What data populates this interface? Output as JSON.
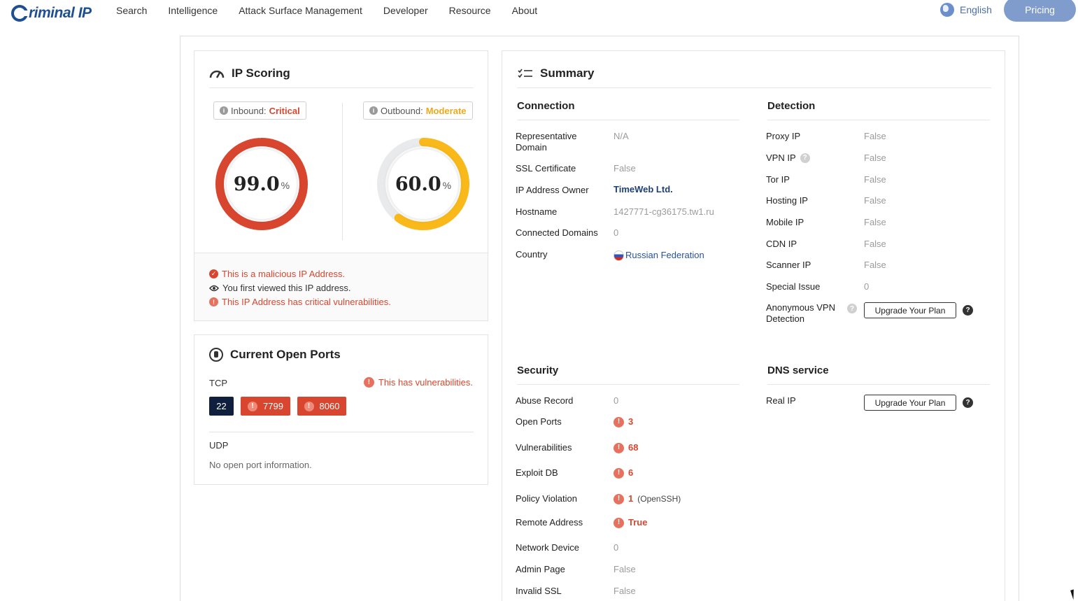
{
  "header": {
    "logo_text": "riminal IP",
    "nav": [
      "Search",
      "Intelligence",
      "Attack Surface Management",
      "Developer",
      "Resource",
      "About"
    ],
    "language": "English",
    "pricing": "Pricing"
  },
  "scoring": {
    "title": "IP Scoring",
    "inbound": {
      "label": "Inbound:",
      "level": "Critical",
      "score": "99.0",
      "pct": "%",
      "fraction": 0.99,
      "color": "#d9462f"
    },
    "outbound": {
      "label": "Outbound:",
      "level": "Moderate",
      "score": "60.0",
      "pct": "%",
      "fraction": 0.6,
      "color": "#f9b91a"
    },
    "messages": [
      {
        "text": "This is a malicious IP Address.",
        "color": "#d9462f"
      },
      {
        "text": "You first viewed this IP address.",
        "color": "#333333"
      },
      {
        "text": "This IP Address has critical vulnerabilities.",
        "color": "#d9462f"
      }
    ]
  },
  "ports": {
    "title": "Current Open Ports",
    "tcp_label": "TCP",
    "vuln_note": "This has vulnerabilities.",
    "tcp": [
      {
        "port": "22",
        "vulnerable": false
      },
      {
        "port": "7799",
        "vulnerable": true
      },
      {
        "port": "8060",
        "vulnerable": true
      }
    ],
    "udp_label": "UDP",
    "udp_empty": "No open port information."
  },
  "summary": {
    "title": "Summary",
    "connection": {
      "heading": "Connection",
      "rows": [
        {
          "key": "Representative Domain",
          "value": "N/A"
        },
        {
          "key": "SSL Certificate",
          "value": "False"
        },
        {
          "key": "IP Address Owner",
          "value": "TimeWeb Ltd."
        },
        {
          "key": "Hostname",
          "value": "1427771-cg36175.tw1.ru"
        },
        {
          "key": "Connected Domains",
          "value": "0"
        },
        {
          "key": "Country",
          "value": "Russian Federation"
        }
      ]
    },
    "detection": {
      "heading": "Detection",
      "rows": [
        {
          "key": "Proxy IP",
          "value": "False"
        },
        {
          "key": "VPN IP",
          "value": "False"
        },
        {
          "key": "Tor IP",
          "value": "False"
        },
        {
          "key": "Hosting IP",
          "value": "False"
        },
        {
          "key": "Mobile IP",
          "value": "False"
        },
        {
          "key": "CDN IP",
          "value": "False"
        },
        {
          "key": "Scanner IP",
          "value": "False"
        },
        {
          "key": "Special Issue",
          "value": "0"
        },
        {
          "key": "Anonymous VPN Detection",
          "value": "Upgrade Your Plan"
        }
      ]
    },
    "security": {
      "heading": "Security",
      "rows": [
        {
          "key": "Abuse Record",
          "value": "0"
        },
        {
          "key": "Open Ports",
          "value": "3"
        },
        {
          "key": "Vulnerabilities",
          "value": "68"
        },
        {
          "key": "Exploit DB",
          "value": "6"
        },
        {
          "key": "Policy Violation",
          "value": "1",
          "extra": "(OpenSSH)"
        },
        {
          "key": "Remote Address",
          "value": "True"
        },
        {
          "key": "Network Device",
          "value": "0"
        },
        {
          "key": "Admin Page",
          "value": "False"
        },
        {
          "key": "Invalid SSL",
          "value": "False"
        }
      ]
    },
    "dns": {
      "heading": "DNS service",
      "rows": [
        {
          "key": "Real IP",
          "value": "Upgrade Your Plan"
        }
      ]
    }
  }
}
